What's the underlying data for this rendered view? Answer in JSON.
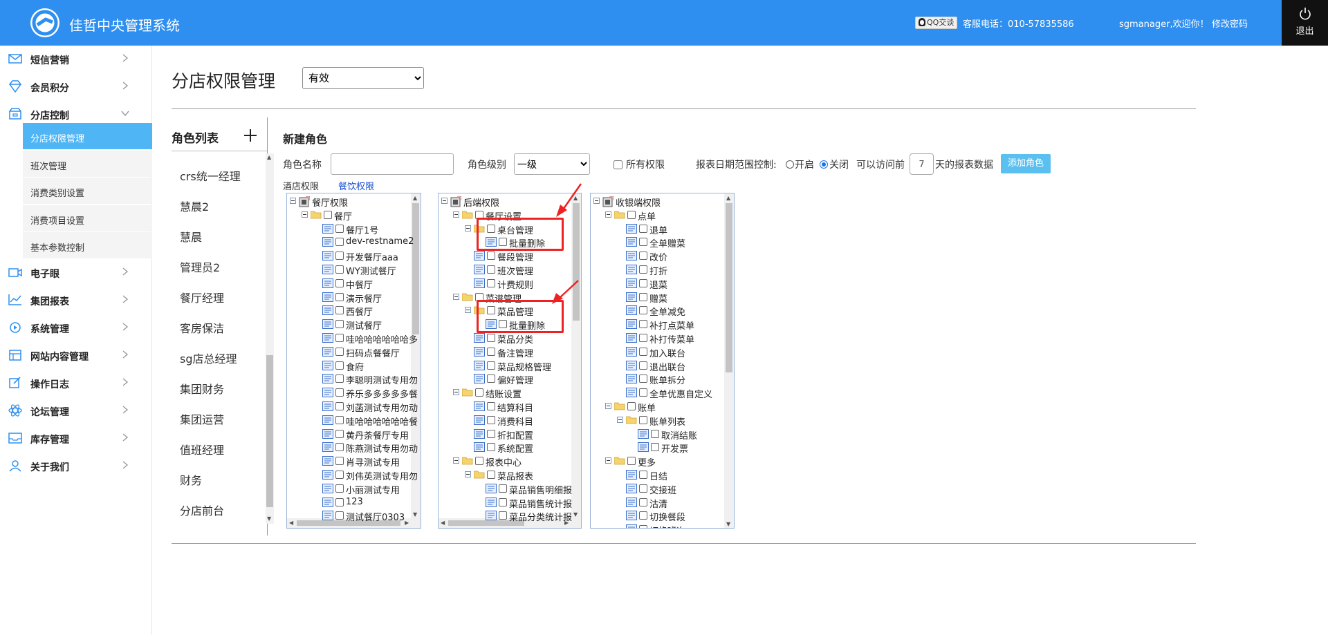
{
  "header": {
    "app_title": "佳哲中央管理系统",
    "qq_badge": "QQ交谈",
    "hotline": "客服电话：010-57835586",
    "welcome": "sgmanager,欢迎你！",
    "change_password": "修改密码",
    "logout": "退出",
    "bg_color": "#2e8ff0"
  },
  "sidebar": {
    "items": [
      {
        "label": "短信营销",
        "icon": "mail-icon"
      },
      {
        "label": "会员积分",
        "icon": "diamond-icon"
      },
      {
        "label": "分店控制",
        "icon": "store-icon",
        "expanded": true
      },
      {
        "label": "电子眼",
        "icon": "camera-icon"
      },
      {
        "label": "集团报表",
        "icon": "chart-icon"
      },
      {
        "label": "系统管理",
        "icon": "system-icon"
      },
      {
        "label": "网站内容管理",
        "icon": "grid-icon"
      },
      {
        "label": "操作日志",
        "icon": "edit-icon"
      },
      {
        "label": "论坛管理",
        "icon": "atom-icon"
      },
      {
        "label": "库存管理",
        "icon": "inbox-icon"
      },
      {
        "label": "关于我们",
        "icon": "user-icon"
      }
    ],
    "sub_items": [
      "分店权限管理",
      "班次管理",
      "消费类别设置",
      "消费项目设置",
      "基本参数控制"
    ],
    "active_sub": "分店权限管理",
    "active_color": "#4fb5f5"
  },
  "main": {
    "page_title": "分店权限管理",
    "status_value": "有效",
    "role_list_title": "角色列表",
    "roles": [
      "crs统一经理",
      "慧晨2",
      "慧晨",
      "管理员2",
      "餐厅经理",
      "客房保洁",
      "sg店总经理",
      "集团财务",
      "集团运营",
      "值班经理",
      "财务",
      "分店前台"
    ],
    "new_role_title": "新建角色",
    "role_name_label": "角色名称",
    "role_level_label": "角色级别",
    "role_level_value": "一级",
    "all_perms_label": "所有权限",
    "date_ctl_label": "报表日期范围控制:",
    "open_label": "开启",
    "close_label": "关闭",
    "access_label": "可以访问前",
    "days_value": "7",
    "report_data_label": "天的报表数据",
    "add_role_button": "添加角色",
    "tab_hotel": "酒店权限",
    "tab_catering": "餐饮权限"
  },
  "trees": {
    "restaurant": [
      "餐厅权限",
      "餐厅",
      "餐厅1号",
      "dev-restname2",
      "开发餐厅aaa",
      "WY测试餐厅",
      "中餐厅",
      "演示餐厅",
      "西餐厅",
      "测试餐厅",
      "哇哈哈哈哈哈哈多",
      "扫码点餐餐厅",
      "食府",
      "李聪明测试专用勿",
      "养乐多多多多多餐",
      "刘菡测试专用勿动",
      "哇哈哈哈哈哈哈餐",
      "黄丹荼餐厅专用",
      "陈燕测试专用勿动",
      "肖寻测试专用",
      "刘伟英测试专用勿",
      "小丽测试专用",
      "123",
      "测试餐厅0303"
    ],
    "backend": [
      "后端权限",
      "餐厅设置",
      "桌台管理",
      "批量删除",
      "餐段管理",
      "班次管理",
      "计费规则",
      "菜谱管理",
      "菜品管理",
      "批量删除",
      "菜品分类",
      "备注管理",
      "菜品规格管理",
      "偏好管理",
      "结账设置",
      "结算科目",
      "消费科目",
      "折扣配置",
      "系统配置",
      "报表中心",
      "菜品报表",
      "菜品销售明细报",
      "菜品销售统计报",
      "菜品分类统计报"
    ],
    "cashier": [
      "收银端权限",
      "点单",
      "退单",
      "全单赠菜",
      "改价",
      "打折",
      "退菜",
      "赠菜",
      "全单减免",
      "补打点菜单",
      "补打传菜单",
      "加入联台",
      "退出联台",
      "账单拆分",
      "全单优惠自定义",
      "账单",
      "账单列表",
      "取消结账",
      "开发票",
      "更多",
      "日结",
      "交接班",
      "沽清",
      "切换餐段",
      "切换班次"
    ]
  }
}
